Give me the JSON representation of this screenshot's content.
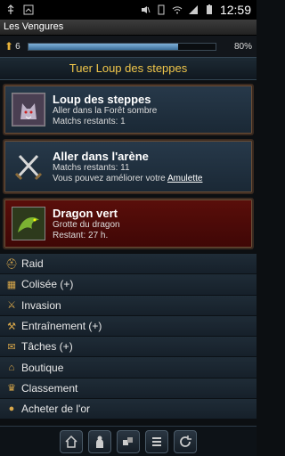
{
  "status_bar": {
    "time": "12:59"
  },
  "app": {
    "title": "Les Vengures"
  },
  "xp": {
    "level": "6",
    "percent_label": "80%",
    "progress": 0.8
  },
  "quest": {
    "title": "Tuer Loup des steppes"
  },
  "cards": [
    {
      "title": "Loup des steppes",
      "line1": "Aller dans la Forêt sombre",
      "line2": "Matchs restants: 1"
    },
    {
      "title": "Aller dans l'arène",
      "line1": "Matchs restants: 11",
      "line2_prefix": "Vous pouvez améliorer votre ",
      "line2_link": "Amulette"
    },
    {
      "title": "Dragon vert",
      "line1": "Grotte du dragon",
      "line2": "Restant: 27 h."
    }
  ],
  "menu": [
    {
      "label": "Raid",
      "icon": "helmet-icon"
    },
    {
      "label": "Colisée (+)",
      "icon": "colosseum-icon"
    },
    {
      "label": "Invasion",
      "icon": "swords-icon"
    },
    {
      "label": "Entraînement (+)",
      "icon": "training-icon"
    },
    {
      "label": "Tâches (+)",
      "icon": "scroll-icon"
    },
    {
      "label": "Boutique",
      "icon": "shop-icon"
    },
    {
      "label": "Classement",
      "icon": "trophy-icon"
    },
    {
      "label": "Acheter de l'or",
      "icon": "gold-coin-icon"
    }
  ],
  "colors": {
    "accent_gold": "#f0c64a",
    "card_blue": "#27394a",
    "card_red": "#5a0e0a"
  }
}
